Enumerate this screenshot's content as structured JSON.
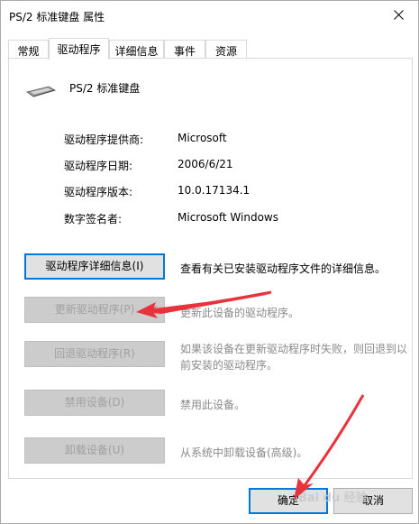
{
  "window": {
    "title": "PS/2 标准键盘 属性",
    "close_icon": "close-icon"
  },
  "tabs": [
    {
      "label": "常规",
      "active": false
    },
    {
      "label": "驱动程序",
      "active": true
    },
    {
      "label": "详细信息",
      "active": false
    },
    {
      "label": "事件",
      "active": false
    },
    {
      "label": "资源",
      "active": false
    }
  ],
  "device": {
    "name": "PS/2 标准键盘",
    "icon": "keyboard-icon"
  },
  "driver_info": [
    {
      "label": "驱动程序提供商:",
      "value": "Microsoft"
    },
    {
      "label": "驱动程序日期:",
      "value": "2006/6/21"
    },
    {
      "label": "驱动程序版本:",
      "value": "10.0.17134.1"
    },
    {
      "label": "数字签名者:",
      "value": "Microsoft Windows"
    }
  ],
  "actions": [
    {
      "label": "驱动程序详细信息(I)",
      "description": "查看有关已安装驱动程序文件的详细信息。",
      "enabled": true
    },
    {
      "label": "更新驱动程序(P)",
      "description": "更新此设备的驱动程序。",
      "enabled": false
    },
    {
      "label": "回退驱动程序(R)",
      "description": "如果该设备在更新驱动程序时失败，则回退到以前安装的驱动程序。",
      "enabled": false
    },
    {
      "label": "禁用设备(D)",
      "description": "禁用此设备。",
      "enabled": false
    },
    {
      "label": "卸载设备(U)",
      "description": "从系统中卸载设备(高级)。",
      "enabled": false
    }
  ],
  "footer": {
    "ok_label": "确定",
    "cancel_label": "取消"
  },
  "annotation_color": "#e8323c",
  "watermark_text": "Bai du 经验"
}
